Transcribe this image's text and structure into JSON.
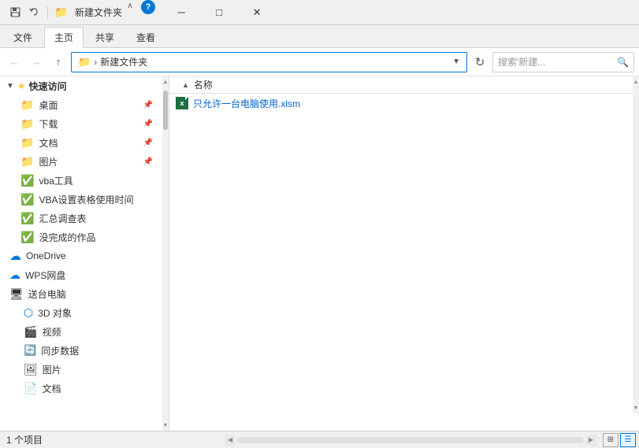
{
  "window": {
    "title": "新建文件夹",
    "title_bar_icons": [
      "save-icon",
      "undo-icon",
      "folder-up-icon"
    ],
    "minimize_label": "─",
    "maximize_label": "□",
    "close_label": "✕"
  },
  "ribbon": {
    "tabs": [
      "文件",
      "主页",
      "共享",
      "查看"
    ],
    "active_tab": "主页"
  },
  "address": {
    "back_disabled": true,
    "forward_disabled": true,
    "up_label": "↑",
    "path_root": "新建文件夹",
    "path_separator": "›",
    "dropdown_label": "▼",
    "refresh_label": "↻",
    "search_placeholder": "搜索'新建...",
    "search_icon": "🔍"
  },
  "sidebar": {
    "quick_access_label": "快速访问",
    "items": [
      {
        "id": "desktop",
        "label": "桌面",
        "icon": "folder",
        "pinned": true
      },
      {
        "id": "downloads",
        "label": "下载",
        "icon": "folder-down",
        "pinned": true
      },
      {
        "id": "documents",
        "label": "文档",
        "icon": "folder-doc",
        "pinned": true
      },
      {
        "id": "pictures",
        "label": "图片",
        "icon": "folder-pic",
        "pinned": true
      },
      {
        "id": "vba-tools",
        "label": "vba工具",
        "icon": "check",
        "pinned": false
      },
      {
        "id": "vba-settings",
        "label": "VBA设置表格使用时间",
        "icon": "check",
        "pinned": false
      },
      {
        "id": "summary",
        "label": "汇总调查表",
        "icon": "check",
        "pinned": false
      },
      {
        "id": "works",
        "label": "没完成的作品",
        "icon": "check",
        "pinned": false
      },
      {
        "id": "onedrive",
        "label": "OneDrive",
        "icon": "onedrive",
        "pinned": false
      },
      {
        "id": "wps-cloud",
        "label": "WPS网盘",
        "icon": "wps",
        "pinned": false
      },
      {
        "id": "this-pc",
        "label": "送台电脑",
        "icon": "pc",
        "pinned": false
      },
      {
        "id": "3d-objects",
        "label": "3D 对象",
        "icon": "3d",
        "pinned": false
      },
      {
        "id": "videos",
        "label": "视频",
        "icon": "video",
        "pinned": false
      },
      {
        "id": "sync-data",
        "label": "同步数据",
        "icon": "sync",
        "pinned": false
      },
      {
        "id": "pictures2",
        "label": "图片",
        "icon": "pic",
        "pinned": false
      },
      {
        "id": "documents2",
        "label": "文档",
        "icon": "doc",
        "pinned": false
      }
    ]
  },
  "file_list": {
    "column_header": "名称",
    "sort_icon": "▲",
    "files": [
      {
        "name": "只允许一台电脑使用.xlsm",
        "icon": "excel",
        "icon_label": "x"
      }
    ]
  },
  "status_bar": {
    "count_label": "1 个项目",
    "view_list_icon": "list",
    "view_detail_icon": "detail"
  }
}
